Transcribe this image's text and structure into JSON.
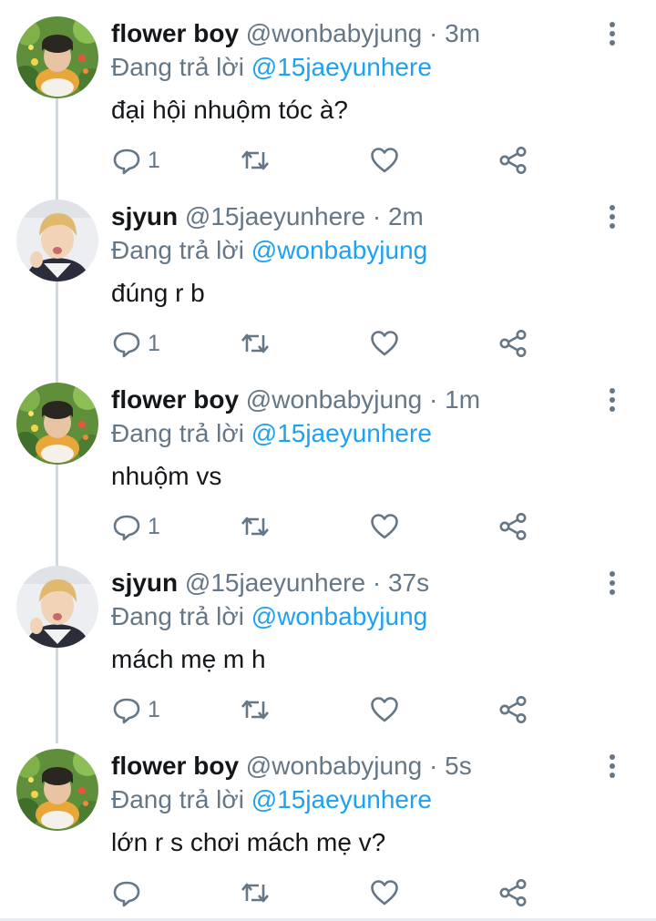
{
  "colors": {
    "text": "#14171a",
    "secondary": "#657786",
    "mention": "#1da1f2",
    "thread_line": "#cfd9de"
  },
  "icons": {
    "reply": "reply-icon",
    "retweet": "retweet-icon",
    "like": "heart-icon",
    "share": "share-icon",
    "more": "more-vertical-icon"
  },
  "tweets": [
    {
      "name": "flower boy",
      "handle": "@wonbabyjung",
      "separator": "·",
      "time": "3m",
      "reply_prefix": "Đang trả lời",
      "reply_to": "@15jaeyunhere",
      "text": "đại hội nhuộm tóc à?",
      "reply_count": "1",
      "avatar": "flower-boy-avatar"
    },
    {
      "name": "sjyun",
      "handle": "@15jaeyunhere",
      "separator": "·",
      "time": "2m",
      "reply_prefix": "Đang trả lời",
      "reply_to": "@wonbabyjung",
      "text": "đúng r b",
      "reply_count": "1",
      "avatar": "sjyun-avatar"
    },
    {
      "name": "flower boy",
      "handle": "@wonbabyjung",
      "separator": "·",
      "time": "1m",
      "reply_prefix": "Đang trả lời",
      "reply_to": "@15jaeyunhere",
      "text": "nhuộm vs",
      "reply_count": "1",
      "avatar": "flower-boy-avatar"
    },
    {
      "name": "sjyun",
      "handle": "@15jaeyunhere",
      "separator": "·",
      "time": "37s",
      "reply_prefix": "Đang trả lời",
      "reply_to": "@wonbabyjung",
      "text": "mách mẹ m h",
      "reply_count": "1",
      "avatar": "sjyun-avatar"
    },
    {
      "name": "flower boy",
      "handle": "@wonbabyjung",
      "separator": "·",
      "time": "5s",
      "reply_prefix": "Đang trả lời",
      "reply_to": "@15jaeyunhere",
      "text": "lớn r s chơi mách mẹ v?",
      "reply_count": "",
      "avatar": "flower-boy-avatar"
    }
  ]
}
